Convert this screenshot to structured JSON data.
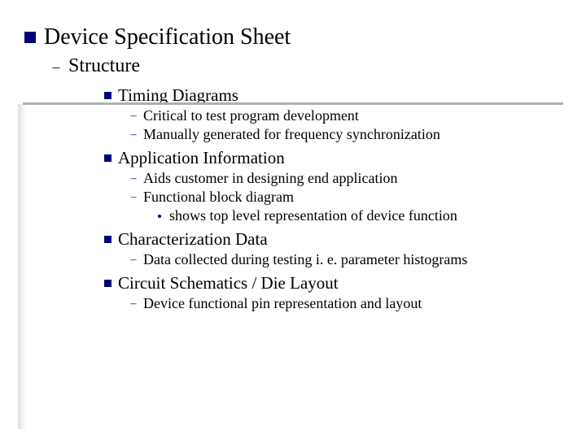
{
  "title": "Device Specification Sheet",
  "structure_label": "Structure",
  "sections": {
    "timing": {
      "heading": "Timing Diagrams",
      "items": [
        "Critical to test program development",
        "Manually generated for frequency synchronization"
      ]
    },
    "app": {
      "heading": "Application Information",
      "items": [
        "Aids customer in designing end application",
        "Functional block diagram"
      ],
      "sub": "shows top level representation of device function"
    },
    "char": {
      "heading": "Characterization Data",
      "items": [
        "Data collected during testing i. e. parameter histograms"
      ]
    },
    "circuit": {
      "heading": "Circuit Schematics / Die Layout",
      "items": [
        "Device functional pin representation and layout"
      ]
    }
  }
}
